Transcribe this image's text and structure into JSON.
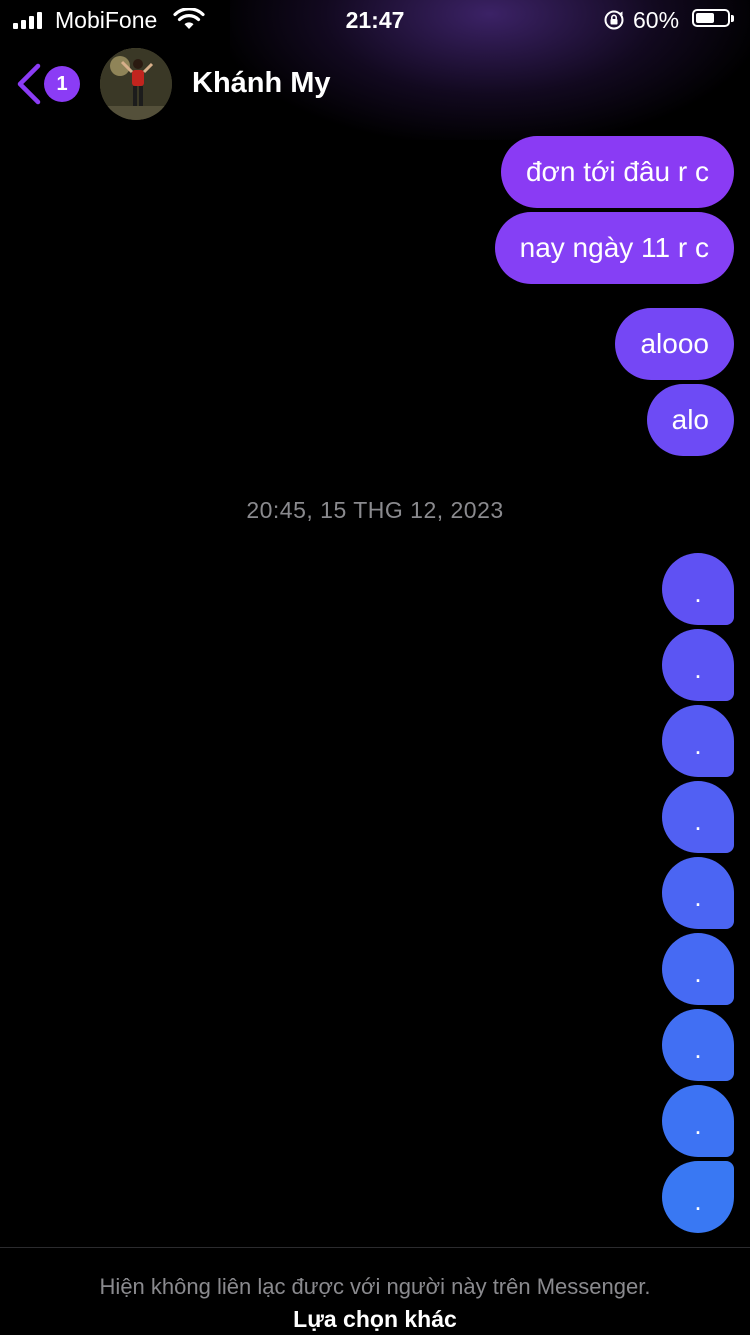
{
  "status_bar": {
    "carrier": "MobiFone",
    "time": "21:47",
    "battery_percent": "60%",
    "battery_level": 0.6
  },
  "header": {
    "back_badge": "1",
    "contact_name": "Khánh My"
  },
  "messages": [
    {
      "text": "đơn tới đâu r c",
      "color": "#8a3bf4"
    },
    {
      "text": "nay ngày 11 r c",
      "color": "#8540f5"
    },
    {
      "text": "alooo",
      "color": "#7547f5"
    },
    {
      "text": "alo",
      "color": "#6d4bf5"
    }
  ],
  "timestamp": "20:45, 15 THG 12, 2023",
  "dot_messages": [
    {
      "text": ".",
      "color": "#5f51f3"
    },
    {
      "text": ".",
      "color": "#5b55f3"
    },
    {
      "text": ".",
      "color": "#565bf3"
    },
    {
      "text": ".",
      "color": "#5160f3"
    },
    {
      "text": ".",
      "color": "#4b65f3"
    },
    {
      "text": ".",
      "color": "#466af3"
    },
    {
      "text": ".",
      "color": "#416ff3"
    },
    {
      "text": ".",
      "color": "#3d73f3"
    },
    {
      "text": ".",
      "color": "#3978f3"
    }
  ],
  "footer": {
    "notice": "Hiện không liên lạc được với người này trên Messenger.",
    "other_options": "Lựa chọn khác"
  },
  "colors": {
    "accent": "#8b3cf5",
    "background": "#000000",
    "muted_text": "#8a8a8e"
  }
}
